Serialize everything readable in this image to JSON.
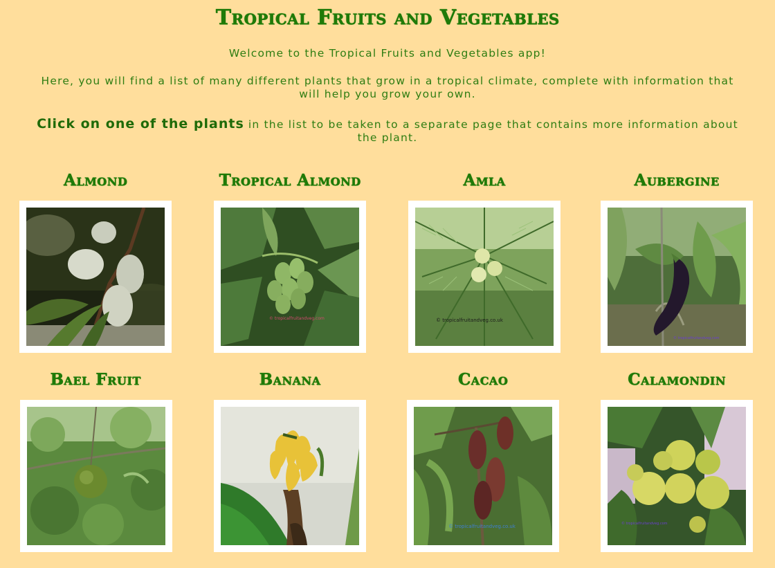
{
  "header": {
    "title": "Tropical Fruits and Vegetables",
    "welcome": "Welcome to the Tropical Fruits and Vegetables app!",
    "description": "Here, you will find a list of many different plants that grow in a tropical climate, complete with information that will help you grow your own.",
    "click_bold": "Click on one of the plants",
    "click_rest": " in the list to be taken to a separate page that contains more information about the plant."
  },
  "plants": [
    {
      "name": "Almond",
      "icon": "almond-photo"
    },
    {
      "name": "Tropical Almond",
      "icon": "tropical-almond-photo",
      "watermark": "© tropicalfruitandveg.com"
    },
    {
      "name": "Amla",
      "icon": "amla-photo",
      "watermark": "© tropicalfruitandveg.co.uk"
    },
    {
      "name": "Aubergine",
      "icon": "aubergine-photo",
      "watermark": "© tropicalfruitandveg.com"
    },
    {
      "name": "Bael Fruit",
      "icon": "bael-fruit-photo"
    },
    {
      "name": "Banana",
      "icon": "banana-photo"
    },
    {
      "name": "Cacao",
      "icon": "cacao-photo",
      "watermark": "© tropicalfruitandveg.co.uk"
    },
    {
      "name": "Calamondin",
      "icon": "calamondin-photo",
      "watermark": "© tropicalfruitandveg.com"
    }
  ],
  "colors": {
    "background": "#FFDE9C",
    "text": "#2E7D12",
    "heading": "#1F7A08",
    "frame": "#ffffff"
  }
}
